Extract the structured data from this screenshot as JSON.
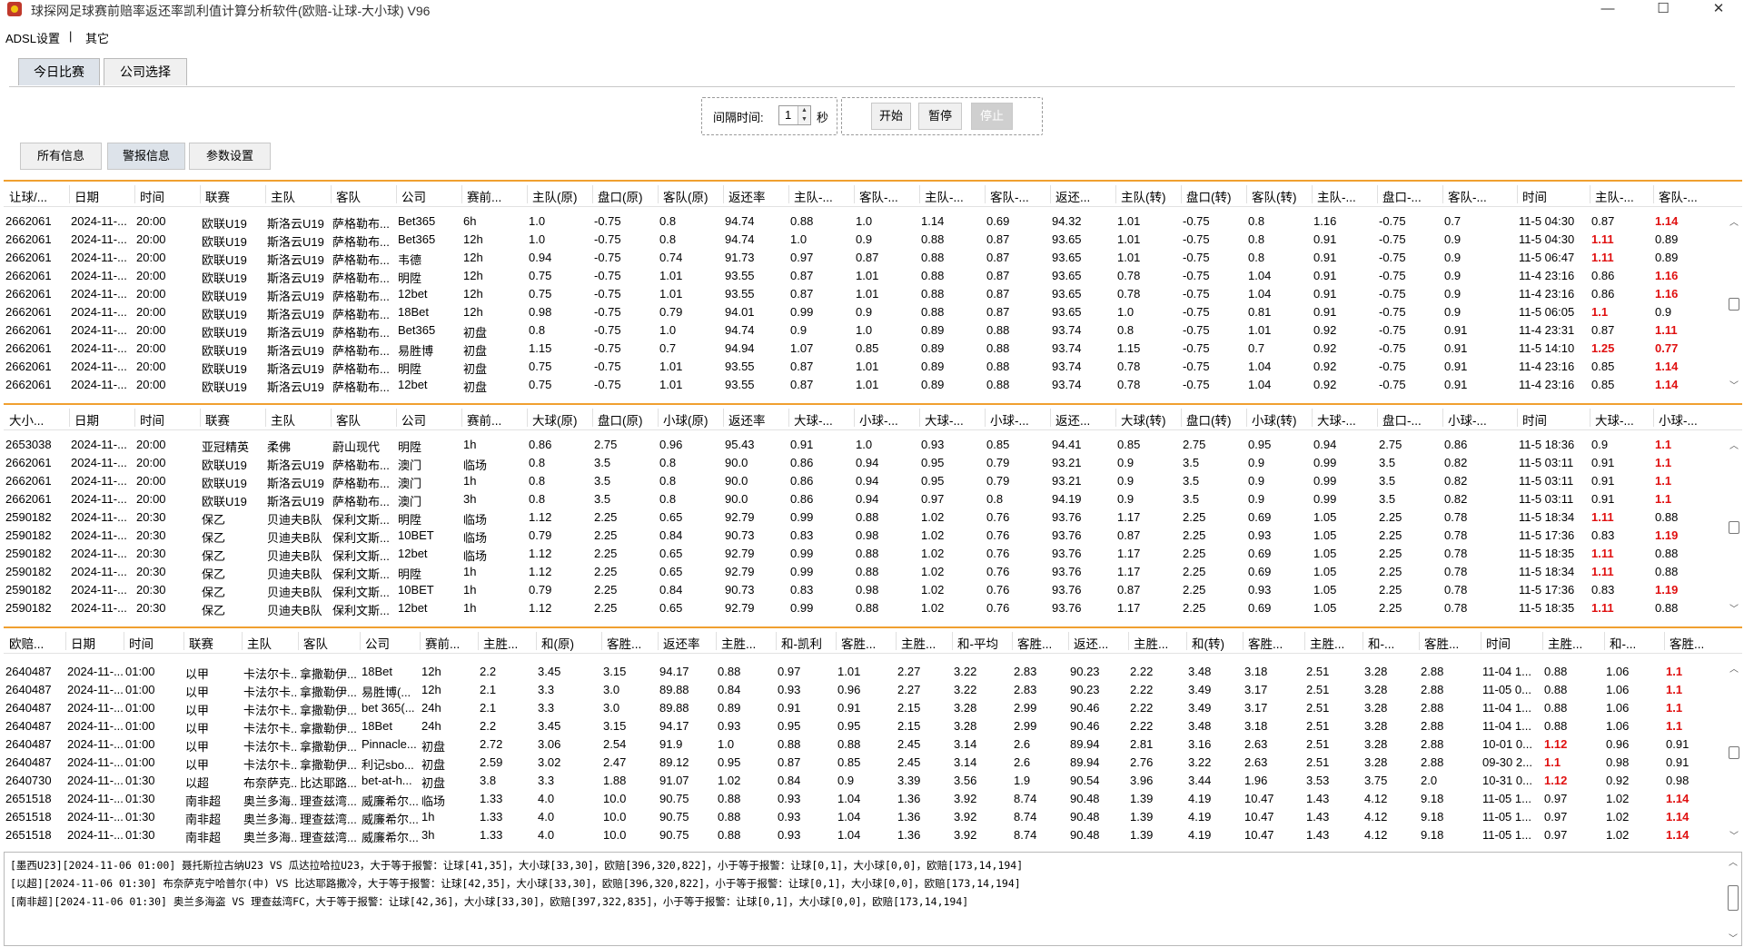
{
  "window": {
    "title": "球探网足球赛前赔率返还率凯利值计算分析软件(欧赔-让球-大小球) V96",
    "min_glyph": "—",
    "max_glyph": "☐",
    "close_glyph": "✕"
  },
  "menu": {
    "items": [
      "ADSL设置",
      "|",
      "其它"
    ]
  },
  "top_tabs": [
    "今日比赛",
    "公司选择"
  ],
  "controls": {
    "interval_label": "间隔时间:",
    "interval_value": "1",
    "unit": "秒",
    "start": "开始",
    "pause": "暂停",
    "stop": "停止"
  },
  "sub_tabs": [
    "所有信息",
    "警报信息",
    "参数设置"
  ],
  "colors": {
    "accent": "#f0a030",
    "highlight": "#e01010"
  },
  "table1": {
    "headers": [
      "让球/...",
      "日期",
      "时间",
      "联赛",
      "主队",
      "客队",
      "公司",
      "赛前...",
      "主队(原)",
      "盘口(原)",
      "客队(原)",
      "返还率",
      "主队-...",
      "客队-...",
      "主队-...",
      "客队-...",
      "返还...",
      "主队(转)",
      "盘口(转)",
      "客队(转)",
      "主队-...",
      "盘口-...",
      "客队-...",
      "时间",
      "主队-...",
      "客队-..."
    ],
    "rows": [
      [
        "2662061",
        "2024-11-...",
        "20:00",
        "欧联U19",
        "斯洛云U19",
        "萨格勒布...",
        "Bet365",
        "6h",
        "1.0",
        "-0.75",
        "0.8",
        "94.74",
        "0.88",
        "1.0",
        "1.14",
        "0.69",
        "94.32",
        "1.01",
        "-0.75",
        "0.8",
        "1.16",
        "-0.75",
        "0.7",
        "11-5 04:30",
        "0.87",
        "1.14"
      ],
      [
        "2662061",
        "2024-11-...",
        "20:00",
        "欧联U19",
        "斯洛云U19",
        "萨格勒布...",
        "Bet365",
        "12h",
        "1.0",
        "-0.75",
        "0.8",
        "94.74",
        "1.0",
        "0.9",
        "0.88",
        "0.87",
        "93.65",
        "1.01",
        "-0.75",
        "0.8",
        "0.91",
        "-0.75",
        "0.9",
        "11-5 04:30",
        "1.11",
        "0.89"
      ],
      [
        "2662061",
        "2024-11-...",
        "20:00",
        "欧联U19",
        "斯洛云U19",
        "萨格勒布...",
        "韦德",
        "12h",
        "0.94",
        "-0.75",
        "0.74",
        "91.73",
        "0.97",
        "0.87",
        "0.88",
        "0.87",
        "93.65",
        "1.01",
        "-0.75",
        "0.8",
        "0.91",
        "-0.75",
        "0.9",
        "11-5 06:47",
        "1.11",
        "0.89"
      ],
      [
        "2662061",
        "2024-11-...",
        "20:00",
        "欧联U19",
        "斯洛云U19",
        "萨格勒布...",
        "明陞",
        "12h",
        "0.75",
        "-0.75",
        "1.01",
        "93.55",
        "0.87",
        "1.01",
        "0.88",
        "0.87",
        "93.65",
        "0.78",
        "-0.75",
        "1.04",
        "0.91",
        "-0.75",
        "0.9",
        "11-4 23:16",
        "0.86",
        "1.16"
      ],
      [
        "2662061",
        "2024-11-...",
        "20:00",
        "欧联U19",
        "斯洛云U19",
        "萨格勒布...",
        "12bet",
        "12h",
        "0.75",
        "-0.75",
        "1.01",
        "93.55",
        "0.87",
        "1.01",
        "0.88",
        "0.87",
        "93.65",
        "0.78",
        "-0.75",
        "1.04",
        "0.91",
        "-0.75",
        "0.9",
        "11-4 23:16",
        "0.86",
        "1.16"
      ],
      [
        "2662061",
        "2024-11-...",
        "20:00",
        "欧联U19",
        "斯洛云U19",
        "萨格勒布...",
        "18Bet",
        "12h",
        "0.98",
        "-0.75",
        "0.79",
        "94.01",
        "0.99",
        "0.9",
        "0.88",
        "0.87",
        "93.65",
        "1.0",
        "-0.75",
        "0.81",
        "0.91",
        "-0.75",
        "0.9",
        "11-5 06:05",
        "1.1",
        "0.9"
      ],
      [
        "2662061",
        "2024-11-...",
        "20:00",
        "欧联U19",
        "斯洛云U19",
        "萨格勒布...",
        "Bet365",
        "初盘",
        "0.8",
        "-0.75",
        "1.0",
        "94.74",
        "0.9",
        "1.0",
        "0.89",
        "0.88",
        "93.74",
        "0.8",
        "-0.75",
        "1.01",
        "0.92",
        "-0.75",
        "0.91",
        "11-4 23:31",
        "0.87",
        "1.11"
      ],
      [
        "2662061",
        "2024-11-...",
        "20:00",
        "欧联U19",
        "斯洛云U19",
        "萨格勒布...",
        "易胜博",
        "初盘",
        "1.15",
        "-0.75",
        "0.7",
        "94.94",
        "1.07",
        "0.85",
        "0.89",
        "0.88",
        "93.74",
        "1.15",
        "-0.75",
        "0.7",
        "0.92",
        "-0.75",
        "0.91",
        "11-5 14:10",
        "1.25",
        "0.77"
      ],
      [
        "2662061",
        "2024-11-...",
        "20:00",
        "欧联U19",
        "斯洛云U19",
        "萨格勒布...",
        "明陞",
        "初盘",
        "0.75",
        "-0.75",
        "1.01",
        "93.55",
        "0.87",
        "1.01",
        "0.89",
        "0.88",
        "93.74",
        "0.78",
        "-0.75",
        "1.04",
        "0.92",
        "-0.75",
        "0.91",
        "11-4 23:16",
        "0.85",
        "1.14"
      ],
      [
        "2662061",
        "2024-11-...",
        "20:00",
        "欧联U19",
        "斯洛云U19",
        "萨格勒布...",
        "12bet",
        "初盘",
        "0.75",
        "-0.75",
        "1.01",
        "93.55",
        "0.87",
        "1.01",
        "0.89",
        "0.88",
        "93.74",
        "0.78",
        "-0.75",
        "1.04",
        "0.92",
        "-0.75",
        "0.91",
        "11-4 23:16",
        "0.85",
        "1.14"
      ]
    ],
    "highlights": [
      [
        0,
        25
      ],
      [
        1,
        24
      ],
      [
        2,
        24
      ],
      [
        3,
        25
      ],
      [
        4,
        25
      ],
      [
        5,
        24
      ],
      [
        6,
        25
      ],
      [
        7,
        24
      ],
      [
        7,
        25
      ],
      [
        8,
        25
      ],
      [
        9,
        25
      ]
    ]
  },
  "table2": {
    "headers": [
      "大小...",
      "日期",
      "时间",
      "联赛",
      "主队",
      "客队",
      "公司",
      "赛前...",
      "大球(原)",
      "盘口(原)",
      "小球(原)",
      "返还率",
      "大球-...",
      "小球-...",
      "大球-...",
      "小球-...",
      "返还...",
      "大球(转)",
      "盘口(转)",
      "小球(转)",
      "大球-...",
      "盘口-...",
      "小球-...",
      "时间",
      "大球-...",
      "小球-..."
    ],
    "rows": [
      [
        "2653038",
        "2024-11-...",
        "20:00",
        "亚冠精英",
        "柔佛",
        "蔚山现代",
        "明陞",
        "1h",
        "0.86",
        "2.75",
        "0.96",
        "95.43",
        "0.91",
        "1.0",
        "0.93",
        "0.85",
        "94.41",
        "0.85",
        "2.75",
        "0.95",
        "0.94",
        "2.75",
        "0.86",
        "11-5 18:36",
        "0.9",
        "1.1"
      ],
      [
        "2662061",
        "2024-11-...",
        "20:00",
        "欧联U19",
        "斯洛云U19",
        "萨格勒布...",
        "澳门",
        "临场",
        "0.8",
        "3.5",
        "0.8",
        "90.0",
        "0.86",
        "0.94",
        "0.95",
        "0.79",
        "93.21",
        "0.9",
        "3.5",
        "0.9",
        "0.99",
        "3.5",
        "0.82",
        "11-5 03:11",
        "0.91",
        "1.1"
      ],
      [
        "2662061",
        "2024-11-...",
        "20:00",
        "欧联U19",
        "斯洛云U19",
        "萨格勒布...",
        "澳门",
        "1h",
        "0.8",
        "3.5",
        "0.8",
        "90.0",
        "0.86",
        "0.94",
        "0.95",
        "0.79",
        "93.21",
        "0.9",
        "3.5",
        "0.9",
        "0.99",
        "3.5",
        "0.82",
        "11-5 03:11",
        "0.91",
        "1.1"
      ],
      [
        "2662061",
        "2024-11-...",
        "20:00",
        "欧联U19",
        "斯洛云U19",
        "萨格勒布...",
        "澳门",
        "3h",
        "0.8",
        "3.5",
        "0.8",
        "90.0",
        "0.86",
        "0.94",
        "0.97",
        "0.8",
        "94.19",
        "0.9",
        "3.5",
        "0.9",
        "0.99",
        "3.5",
        "0.82",
        "11-5 03:11",
        "0.91",
        "1.1"
      ],
      [
        "2590182",
        "2024-11-...",
        "20:30",
        "保乙",
        "贝迪夫B队",
        "保利文斯...",
        "明陞",
        "临场",
        "1.12",
        "2.25",
        "0.65",
        "92.79",
        "0.99",
        "0.88",
        "1.02",
        "0.76",
        "93.76",
        "1.17",
        "2.25",
        "0.69",
        "1.05",
        "2.25",
        "0.78",
        "11-5 18:34",
        "1.11",
        "0.88"
      ],
      [
        "2590182",
        "2024-11-...",
        "20:30",
        "保乙",
        "贝迪夫B队",
        "保利文斯...",
        "10BET",
        "临场",
        "0.79",
        "2.25",
        "0.84",
        "90.73",
        "0.83",
        "0.98",
        "1.02",
        "0.76",
        "93.76",
        "0.87",
        "2.25",
        "0.93",
        "1.05",
        "2.25",
        "0.78",
        "11-5 17:36",
        "0.83",
        "1.19"
      ],
      [
        "2590182",
        "2024-11-...",
        "20:30",
        "保乙",
        "贝迪夫B队",
        "保利文斯...",
        "12bet",
        "临场",
        "1.12",
        "2.25",
        "0.65",
        "92.79",
        "0.99",
        "0.88",
        "1.02",
        "0.76",
        "93.76",
        "1.17",
        "2.25",
        "0.69",
        "1.05",
        "2.25",
        "0.78",
        "11-5 18:35",
        "1.11",
        "0.88"
      ],
      [
        "2590182",
        "2024-11-...",
        "20:30",
        "保乙",
        "贝迪夫B队",
        "保利文斯...",
        "明陞",
        "1h",
        "1.12",
        "2.25",
        "0.65",
        "92.79",
        "0.99",
        "0.88",
        "1.02",
        "0.76",
        "93.76",
        "1.17",
        "2.25",
        "0.69",
        "1.05",
        "2.25",
        "0.78",
        "11-5 18:34",
        "1.11",
        "0.88"
      ],
      [
        "2590182",
        "2024-11-...",
        "20:30",
        "保乙",
        "贝迪夫B队",
        "保利文斯...",
        "10BET",
        "1h",
        "0.79",
        "2.25",
        "0.84",
        "90.73",
        "0.83",
        "0.98",
        "1.02",
        "0.76",
        "93.76",
        "0.87",
        "2.25",
        "0.93",
        "1.05",
        "2.25",
        "0.78",
        "11-5 17:36",
        "0.83",
        "1.19"
      ],
      [
        "2590182",
        "2024-11-...",
        "20:30",
        "保乙",
        "贝迪夫B队",
        "保利文斯...",
        "12bet",
        "1h",
        "1.12",
        "2.25",
        "0.65",
        "92.79",
        "0.99",
        "0.88",
        "1.02",
        "0.76",
        "93.76",
        "1.17",
        "2.25",
        "0.69",
        "1.05",
        "2.25",
        "0.78",
        "11-5 18:35",
        "1.11",
        "0.88"
      ]
    ],
    "highlights": [
      [
        0,
        25
      ],
      [
        1,
        25
      ],
      [
        2,
        25
      ],
      [
        3,
        25
      ],
      [
        4,
        24
      ],
      [
        5,
        25
      ],
      [
        6,
        24
      ],
      [
        7,
        24
      ],
      [
        8,
        25
      ],
      [
        9,
        24
      ]
    ]
  },
  "table3": {
    "headers": [
      "欧赔...",
      "日期",
      "时间",
      "联赛",
      "主队",
      "客队",
      "公司",
      "赛前...",
      "主胜...",
      "和(原)",
      "客胜...",
      "返还率",
      "主胜...",
      "和-凯利",
      "客胜...",
      "主胜...",
      "和-平均",
      "客胜...",
      "返还...",
      "主胜...",
      "和(转)",
      "客胜...",
      "主胜...",
      "和-...",
      "客胜...",
      "时间",
      "主胜...",
      "和-...",
      "客胜..."
    ],
    "rows": [
      [
        "2640487",
        "2024-11-...",
        "01:00",
        "以甲",
        "卡法尔卡...",
        "拿撒勒伊...",
        "18Bet",
        "12h",
        "2.2",
        "3.45",
        "3.15",
        "94.17",
        "0.88",
        "0.97",
        "1.01",
        "2.27",
        "3.22",
        "2.83",
        "90.23",
        "2.22",
        "3.48",
        "3.18",
        "2.51",
        "3.28",
        "2.88",
        "11-04 1...",
        "0.88",
        "1.06",
        "1.1"
      ],
      [
        "2640487",
        "2024-11-...",
        "01:00",
        "以甲",
        "卡法尔卡...",
        "拿撒勒伊...",
        "易胜博(...",
        "12h",
        "2.1",
        "3.3",
        "3.0",
        "89.88",
        "0.84",
        "0.93",
        "0.96",
        "2.27",
        "3.22",
        "2.83",
        "90.23",
        "2.22",
        "3.49",
        "3.17",
        "2.51",
        "3.28",
        "2.88",
        "11-05 0...",
        "0.88",
        "1.06",
        "1.1"
      ],
      [
        "2640487",
        "2024-11-...",
        "01:00",
        "以甲",
        "卡法尔卡...",
        "拿撒勒伊...",
        "bet 365(...",
        "24h",
        "2.1",
        "3.3",
        "3.0",
        "89.88",
        "0.89",
        "0.91",
        "0.91",
        "2.15",
        "3.28",
        "2.99",
        "90.46",
        "2.22",
        "3.49",
        "3.17",
        "2.51",
        "3.28",
        "2.88",
        "11-04 1...",
        "0.88",
        "1.06",
        "1.1"
      ],
      [
        "2640487",
        "2024-11-...",
        "01:00",
        "以甲",
        "卡法尔卡...",
        "拿撒勒伊...",
        "18Bet",
        "24h",
        "2.2",
        "3.45",
        "3.15",
        "94.17",
        "0.93",
        "0.95",
        "0.95",
        "2.15",
        "3.28",
        "2.99",
        "90.46",
        "2.22",
        "3.48",
        "3.18",
        "2.51",
        "3.28",
        "2.88",
        "11-04 1...",
        "0.88",
        "1.06",
        "1.1"
      ],
      [
        "2640487",
        "2024-11-...",
        "01:00",
        "以甲",
        "卡法尔卡...",
        "拿撒勒伊...",
        "Pinnacle...",
        "初盘",
        "2.72",
        "3.06",
        "2.54",
        "91.9",
        "1.0",
        "0.88",
        "0.88",
        "2.45",
        "3.14",
        "2.6",
        "89.94",
        "2.81",
        "3.16",
        "2.63",
        "2.51",
        "3.28",
        "2.88",
        "10-01 0...",
        "1.12",
        "0.96",
        "0.91"
      ],
      [
        "2640487",
        "2024-11-...",
        "01:00",
        "以甲",
        "卡法尔卡...",
        "拿撒勒伊...",
        "利记sbo...",
        "初盘",
        "2.59",
        "3.02",
        "2.47",
        "89.12",
        "0.95",
        "0.87",
        "0.85",
        "2.45",
        "3.14",
        "2.6",
        "89.94",
        "2.76",
        "3.22",
        "2.63",
        "2.51",
        "3.28",
        "2.88",
        "09-30 2...",
        "1.1",
        "0.98",
        "0.91"
      ],
      [
        "2640730",
        "2024-11-...",
        "01:30",
        "以超",
        "布奈萨克...",
        "比达耶路...",
        "bet-at-h...",
        "初盘",
        "3.8",
        "3.3",
        "1.88",
        "91.07",
        "1.02",
        "0.84",
        "0.9",
        "3.39",
        "3.56",
        "1.9",
        "90.54",
        "3.96",
        "3.44",
        "1.96",
        "3.53",
        "3.75",
        "2.0",
        "10-31 0...",
        "1.12",
        "0.92",
        "0.98"
      ],
      [
        "2651518",
        "2024-11-...",
        "01:30",
        "南非超",
        "奥兰多海...",
        "理查兹湾...",
        "威廉希尔...",
        "临场",
        "1.33",
        "4.0",
        "10.0",
        "90.75",
        "0.88",
        "0.93",
        "1.04",
        "1.36",
        "3.92",
        "8.74",
        "90.48",
        "1.39",
        "4.19",
        "10.47",
        "1.43",
        "4.12",
        "9.18",
        "11-05 1...",
        "0.97",
        "1.02",
        "1.14"
      ],
      [
        "2651518",
        "2024-11-...",
        "01:30",
        "南非超",
        "奥兰多海...",
        "理查兹湾...",
        "威廉希尔...",
        "1h",
        "1.33",
        "4.0",
        "10.0",
        "90.75",
        "0.88",
        "0.93",
        "1.04",
        "1.36",
        "3.92",
        "8.74",
        "90.48",
        "1.39",
        "4.19",
        "10.47",
        "1.43",
        "4.12",
        "9.18",
        "11-05 1...",
        "0.97",
        "1.02",
        "1.14"
      ],
      [
        "2651518",
        "2024-11-...",
        "01:30",
        "南非超",
        "奥兰多海...",
        "理查兹湾...",
        "威廉希尔...",
        "3h",
        "1.33",
        "4.0",
        "10.0",
        "90.75",
        "0.88",
        "0.93",
        "1.04",
        "1.36",
        "3.92",
        "8.74",
        "90.48",
        "1.39",
        "4.19",
        "10.47",
        "1.43",
        "4.12",
        "9.18",
        "11-05 1...",
        "0.97",
        "1.02",
        "1.14"
      ]
    ],
    "highlights": [
      [
        0,
        28
      ],
      [
        1,
        28
      ],
      [
        2,
        28
      ],
      [
        3,
        28
      ],
      [
        4,
        26
      ],
      [
        5,
        26
      ],
      [
        6,
        26
      ],
      [
        7,
        28
      ],
      [
        8,
        28
      ],
      [
        9,
        28
      ]
    ]
  },
  "log": {
    "lines": [
      "[墨西U23][2024-11-06 01:00] 聂托斯拉古纳U23 VS 瓜达拉哈拉U23，大于等于报警：让球[41,35]，大小球[33,30]，欧赔[396,320,822]，小于等于报警：让球[0,1]，大小球[0,0]，欧赔[173,14,194]",
      "[以超][2024-11-06 01:30] 布奈萨克宁哈普尔(中) VS 比达耶路撒冷，大于等于报警：让球[42,35]，大小球[33,30]，欧赔[396,320,822]，小于等于报警：让球[0,1]，大小球[0,0]，欧赔[173,14,194]",
      "[南非超][2024-11-06 01:30] 奥兰多海盗 VS 理查兹湾FC，大于等于报警：让球[42,36]，大小球[33,30]，欧赔[397,322,835]，小于等于报警：让球[0,1]，大小球[0,0]，欧赔[173,14,194]"
    ]
  }
}
